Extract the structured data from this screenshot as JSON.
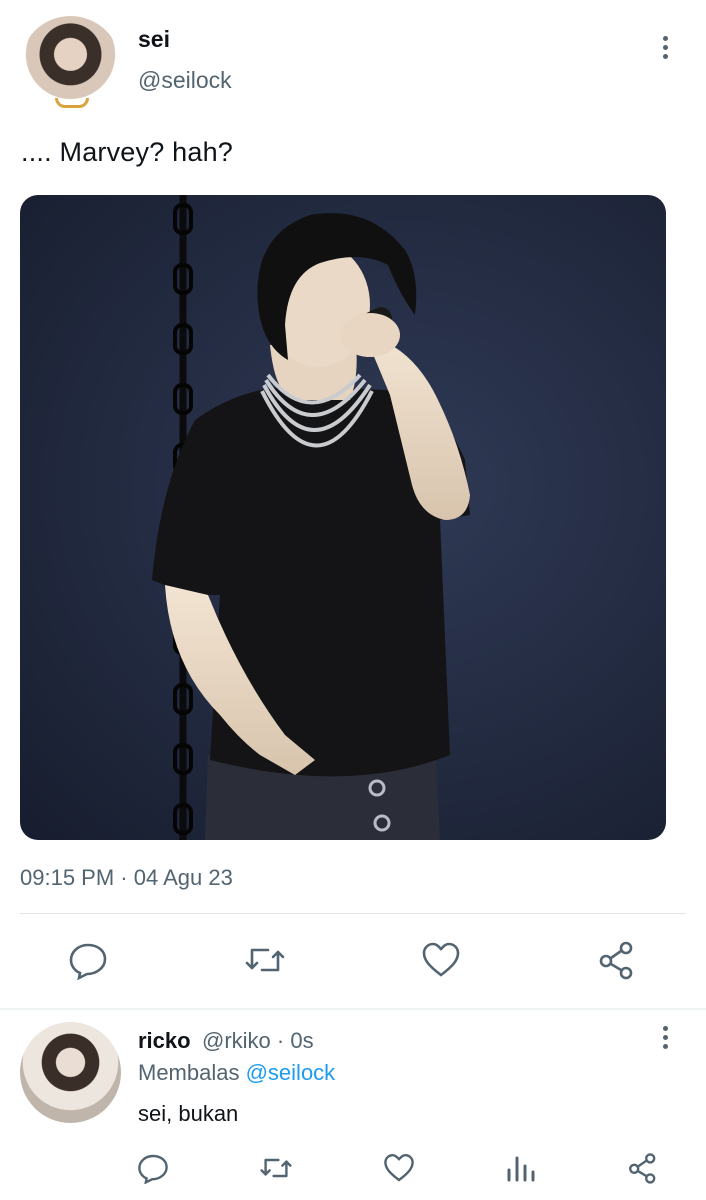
{
  "tweet": {
    "author_name": "sei",
    "author_handle": "@seilock",
    "text": ".... Marvey? hah?",
    "timestamp": "09:15 PM · 04 Agu 23",
    "actions": [
      "reply",
      "retweet",
      "like",
      "share"
    ]
  },
  "reply": {
    "author_name": "ricko",
    "meta": "@rkiko · 0s",
    "replying_prefix": "Membalas ",
    "replying_to": "@seilock",
    "text": "sei, bukan",
    "actions": [
      "reply",
      "retweet",
      "like",
      "views",
      "share"
    ]
  },
  "colors": {
    "secondary_text": "#536471",
    "accent": "#1d9bf0",
    "divider": "#e1e6ea"
  }
}
